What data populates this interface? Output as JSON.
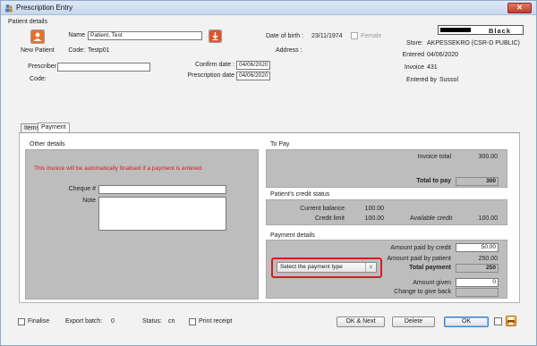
{
  "window": {
    "title": "Prescription Entry",
    "close_glyph": "✕"
  },
  "header": {
    "group_label": "Patient details",
    "new_patient_label": "New Patient",
    "name_label": "Name",
    "name_value": "Patient, Test",
    "code_label": "Code:",
    "code_value": "Testp01",
    "dob_label": "Date of birth :",
    "dob_value": "23/11/1974",
    "female_label": "Female",
    "address_label": "Address :",
    "prescriber_label": "Prescriber",
    "prescriber_value": "",
    "prescriber_code_label": "Code:",
    "confirm_date_label": "Confirm date :",
    "confirm_date_value": "04/06/2020",
    "prescription_date_label": "Prescription date",
    "prescription_date_value": "04/06/2020",
    "store_color_name": "Black",
    "store_label": "Store:",
    "store_value": "AKPESSEKRO (CSR-D PUBLIC)",
    "entered_label": "Entered",
    "entered_value": "04/06/2020",
    "invoice_label": "Invoice",
    "invoice_value": "431",
    "entered_by_label": "Entered by",
    "entered_by_value": "Sussol"
  },
  "tabs": [
    {
      "label": "Items",
      "active": false
    },
    {
      "label": "Payment",
      "active": true
    }
  ],
  "other_details": {
    "title": "Other details",
    "warning": "This invoice will be automatically finalised if a payment is entered.",
    "cheque_label": "Cheque #",
    "cheque_value": "",
    "note_label": "Note",
    "note_value": ""
  },
  "to_pay": {
    "title": "To Pay",
    "invoice_total_label": "Invoice total",
    "invoice_total_value": "300.00",
    "total_to_pay_label": "Total to pay",
    "total_to_pay_value": "300"
  },
  "credit_status": {
    "title": "Patient's credit status",
    "current_balance_label": "Current balance",
    "current_balance_value": "100.00",
    "credit_limit_label": "Credit limit",
    "credit_limit_value": "100.00",
    "available_credit_label": "Available credit",
    "available_credit_value": "100.00"
  },
  "payment_details": {
    "title": "Payment details",
    "payment_type_selected": "Select the payment type",
    "amount_paid_credit_label": "Amount paid by credit",
    "amount_paid_credit_value": "50.00",
    "amount_paid_patient_label": "Amount paid by patient",
    "amount_paid_patient_value": "250.00",
    "total_payment_label": "Total payment",
    "total_payment_value": "250",
    "amount_given_label": "Amount given",
    "amount_given_value": "0",
    "change_label": "Change to give back",
    "change_value": ""
  },
  "footer": {
    "finalise_label": "Finalise",
    "export_batch_label": "Export batch:",
    "export_batch_value": "0",
    "status_label": "Status:",
    "status_value": "cn",
    "print_receipt_label": "Print receipt",
    "ok_next_label": "OK & Next",
    "delete_label": "Delete",
    "ok_label": "OK"
  },
  "colors": {
    "warning": "#d21b1b",
    "highlight": "#d11f1f",
    "panel_gray": "#bdbdbd"
  }
}
